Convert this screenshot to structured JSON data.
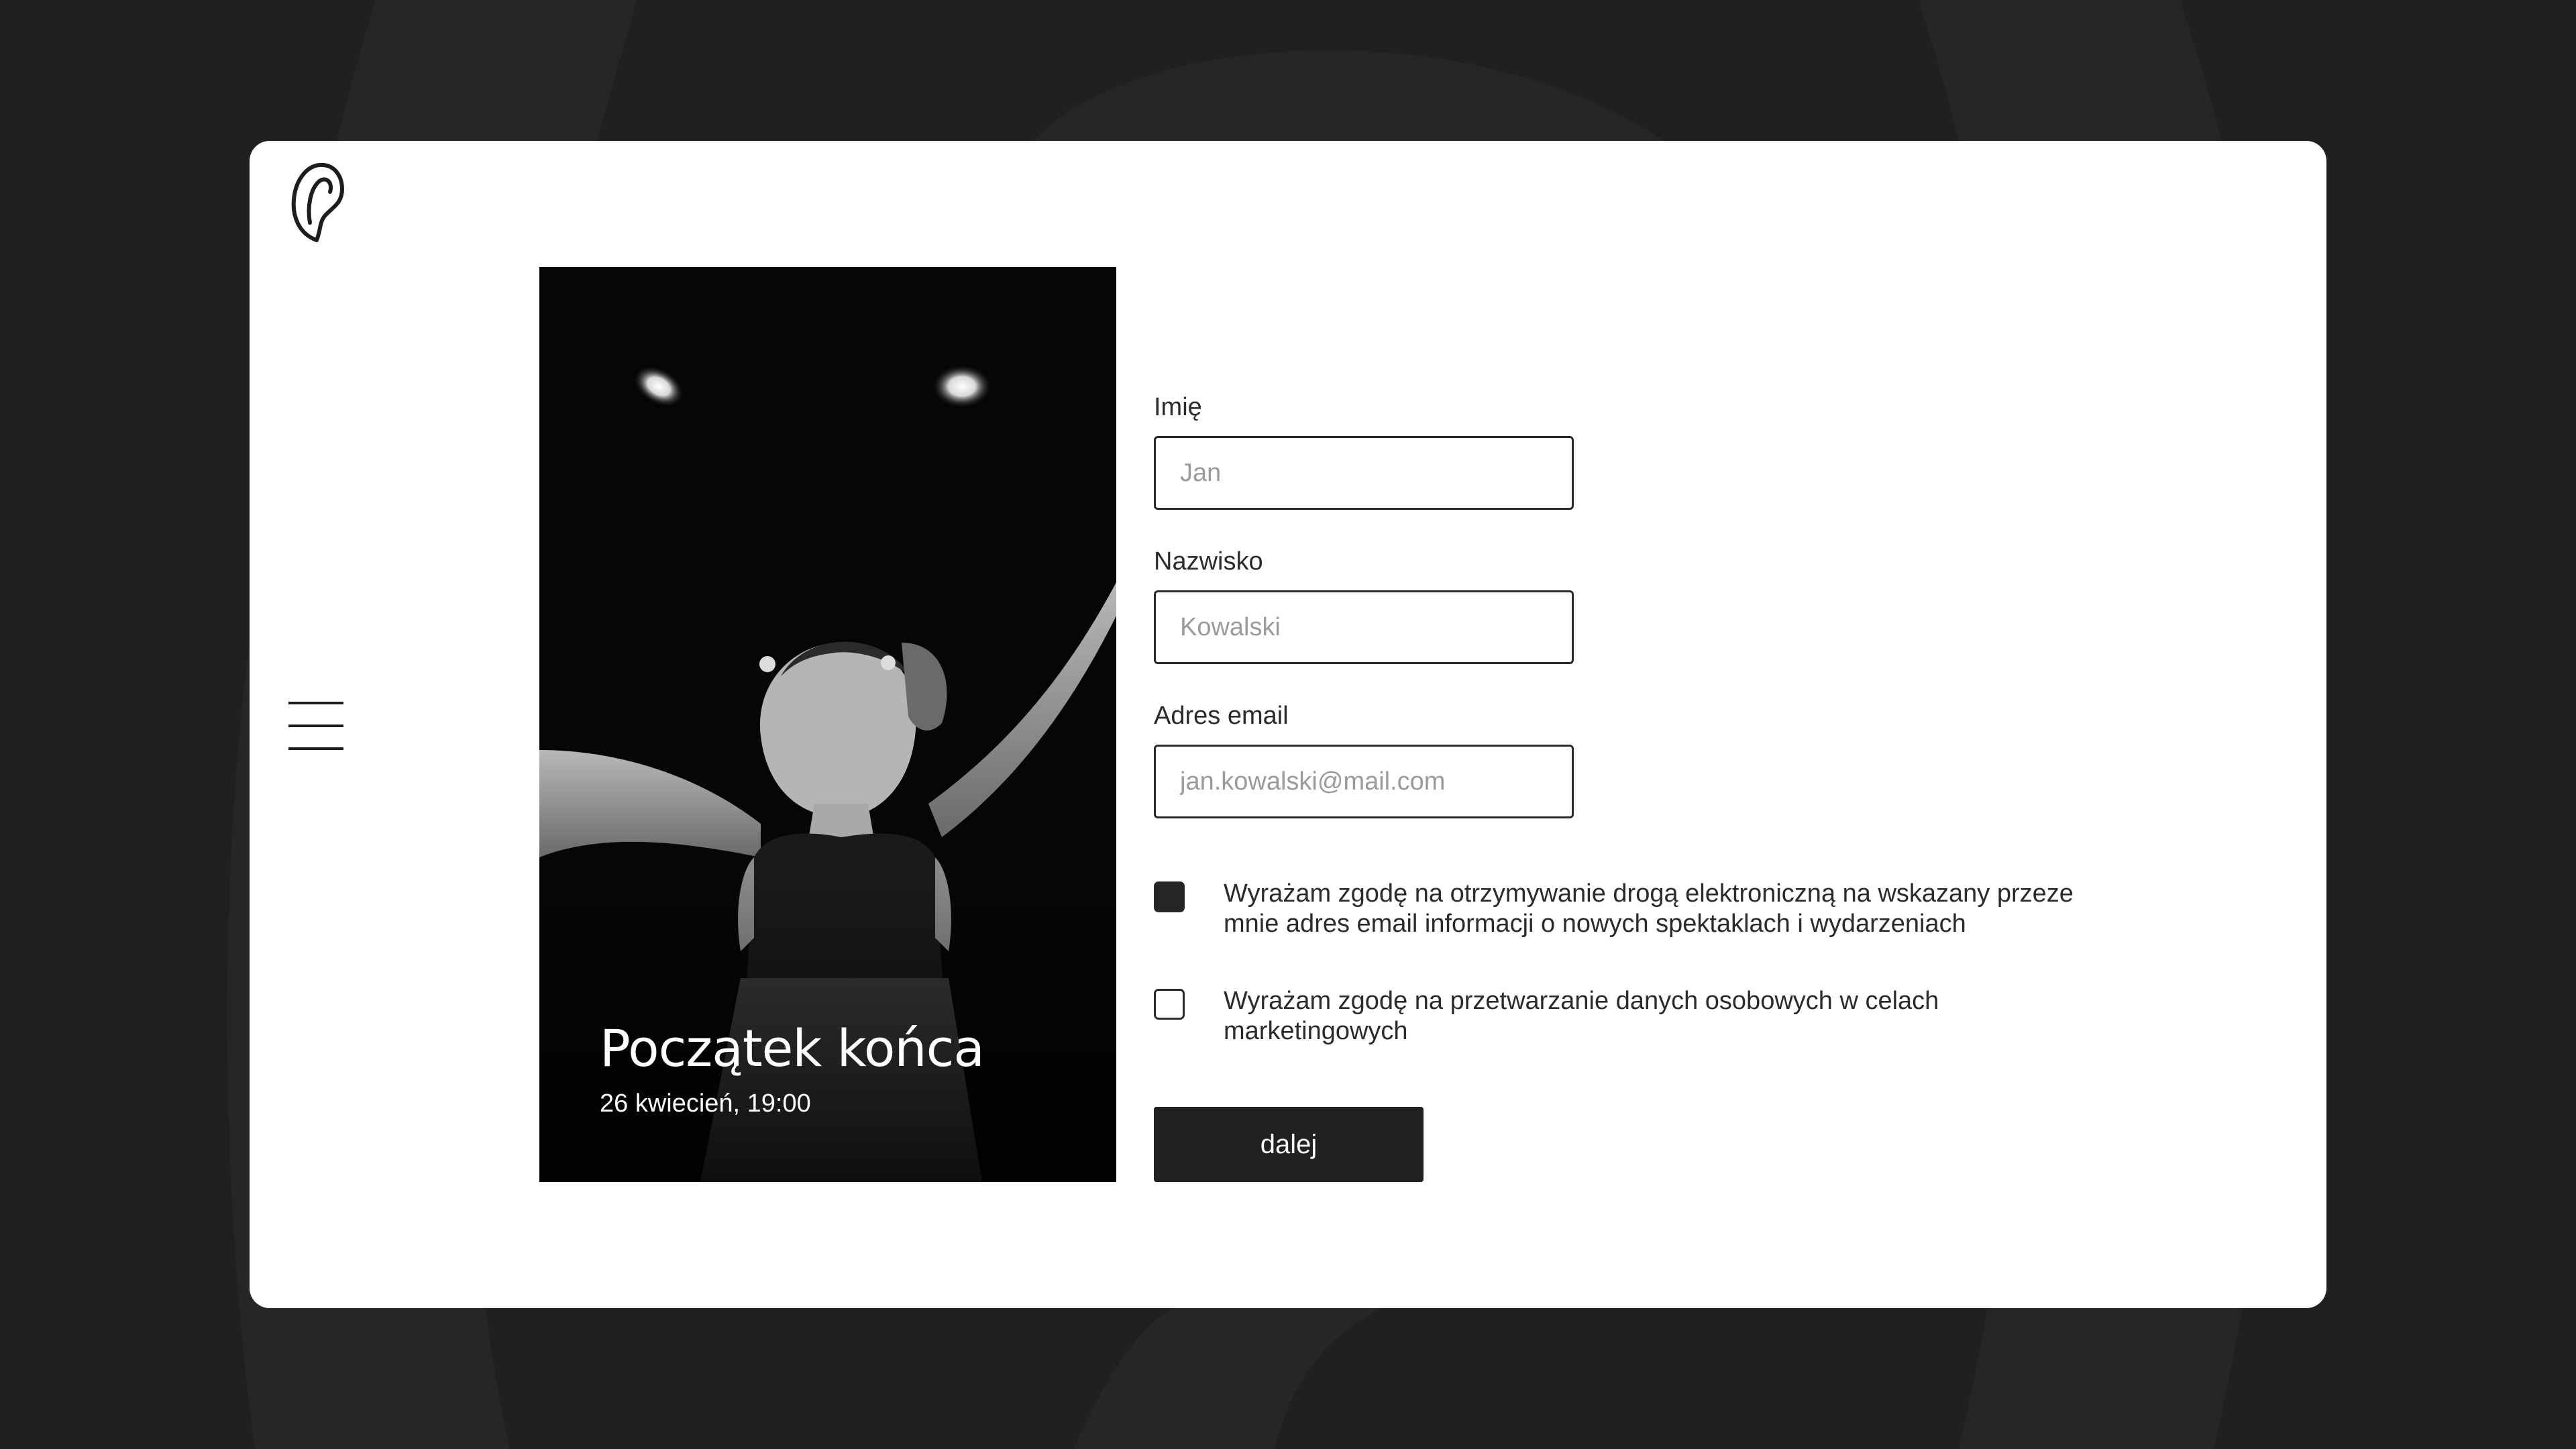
{
  "event": {
    "title": "Początek końca",
    "date": "26 kwiecień, 19:00"
  },
  "form": {
    "first_name": {
      "label": "Imię",
      "placeholder": "Jan"
    },
    "last_name": {
      "label": "Nazwisko",
      "placeholder": "Kowalski"
    },
    "email": {
      "label": "Adres email",
      "placeholder": "jan.kowalski@mail.com"
    },
    "consents": [
      {
        "text": "Wyrażam zgodę na otrzymywanie drogą elektroniczną na wskazany przeze mnie adres email informacji o nowych spektaklach i wydarzeniach",
        "checked": true
      },
      {
        "text": "Wyrażam zgodę na przetwarzanie danych osobowych w celach marketingowych",
        "checked": false
      }
    ],
    "submit_label": "dalej"
  },
  "icons": {
    "logo": "ear-logo-icon",
    "menu": "hamburger-menu-icon"
  },
  "colors": {
    "background": "#202020",
    "card": "#ffffff",
    "button": "#212121",
    "text": "#2b2b2b"
  }
}
